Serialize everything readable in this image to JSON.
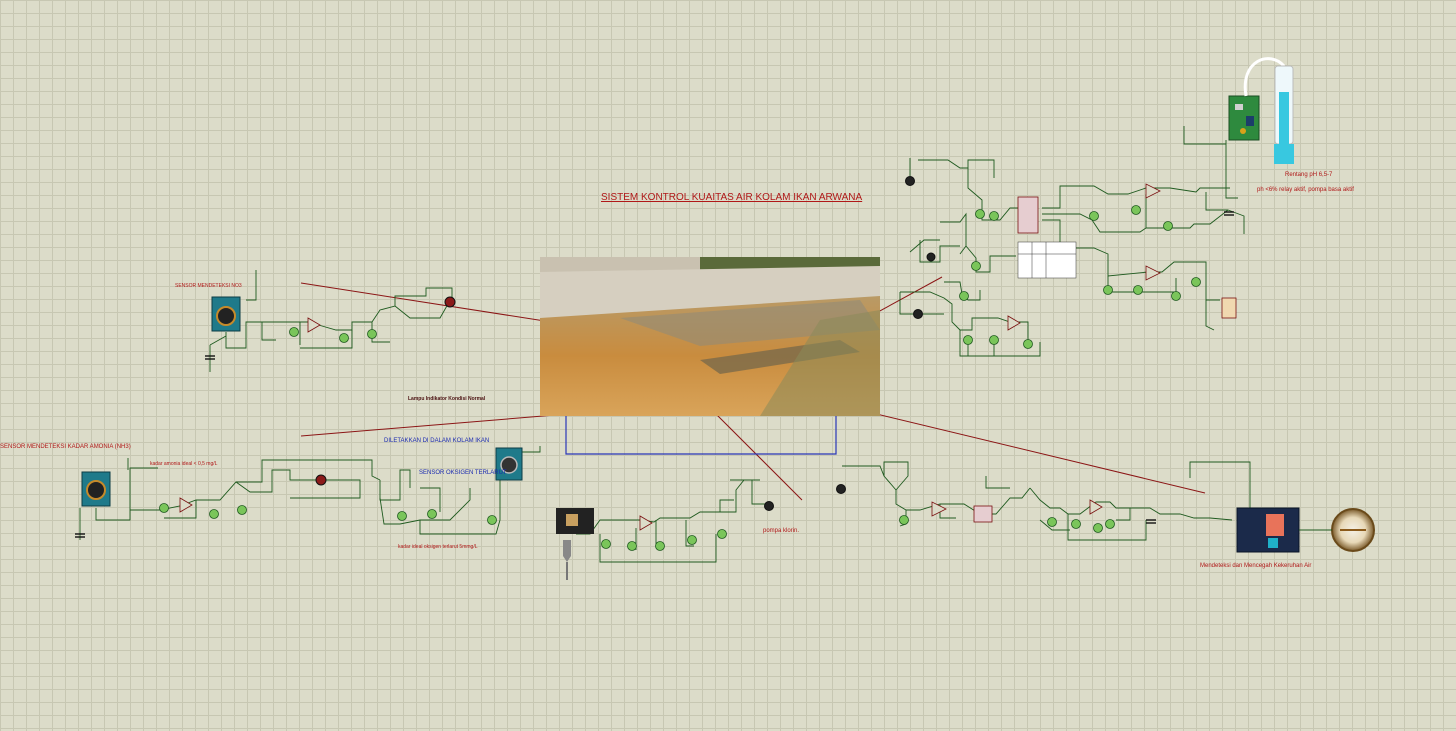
{
  "title": "SISTEM KONTROL KUAITAS AIR KOLAM IKAN ARWANA",
  "labels": {
    "no3_sensor": "SENSOR MENDETEKSI NO3",
    "ammonia_sensor": "SENSOR MENDETEKSI KADAR AMONIA (NH3)",
    "ammonia_level": "kadar amonia ideal < 0,5 mg/L",
    "lamp_indicator": "Lampu Indikator Kondisi Normal",
    "placed_in_pond": "DILETAKKAN DI DALAM KOLAM IKAN",
    "oxygen_sensor": "SENSOR OKSIGEN TERLARUT",
    "oxygen_level": "kadar ideal oksigen terlarut 5mmg/L",
    "chlorine_pump": "pompa klorin.",
    "ph_range": "Rentang pH 6,5-7",
    "ph_note": "ph <6% relay aktif, pompa basa aktif",
    "turbidity": "Mendeteksi dan Mencegah Kekeruhan Air"
  },
  "colors": {
    "background": "#dcdcc9",
    "grid": "#c7c7b2",
    "wire": "#1f5a1f",
    "title": "#b01818",
    "connector_line": "#8b1515",
    "note_blue": "#1a2ab0"
  },
  "icons": {
    "no3_sensor": "sensor-module-icon",
    "ammonia_sensor": "sensor-module-icon",
    "oxygen_sensor": "sensor-module-icon",
    "ph_module": "ph-module-icon",
    "ph_probe": "ph-probe-icon",
    "turbidity_module": "turbidity-module-icon",
    "motor": "motor-icon",
    "voltmeter": "voltmeter-icon",
    "lamp": "lamp-icon",
    "photo": "pond-photo"
  }
}
